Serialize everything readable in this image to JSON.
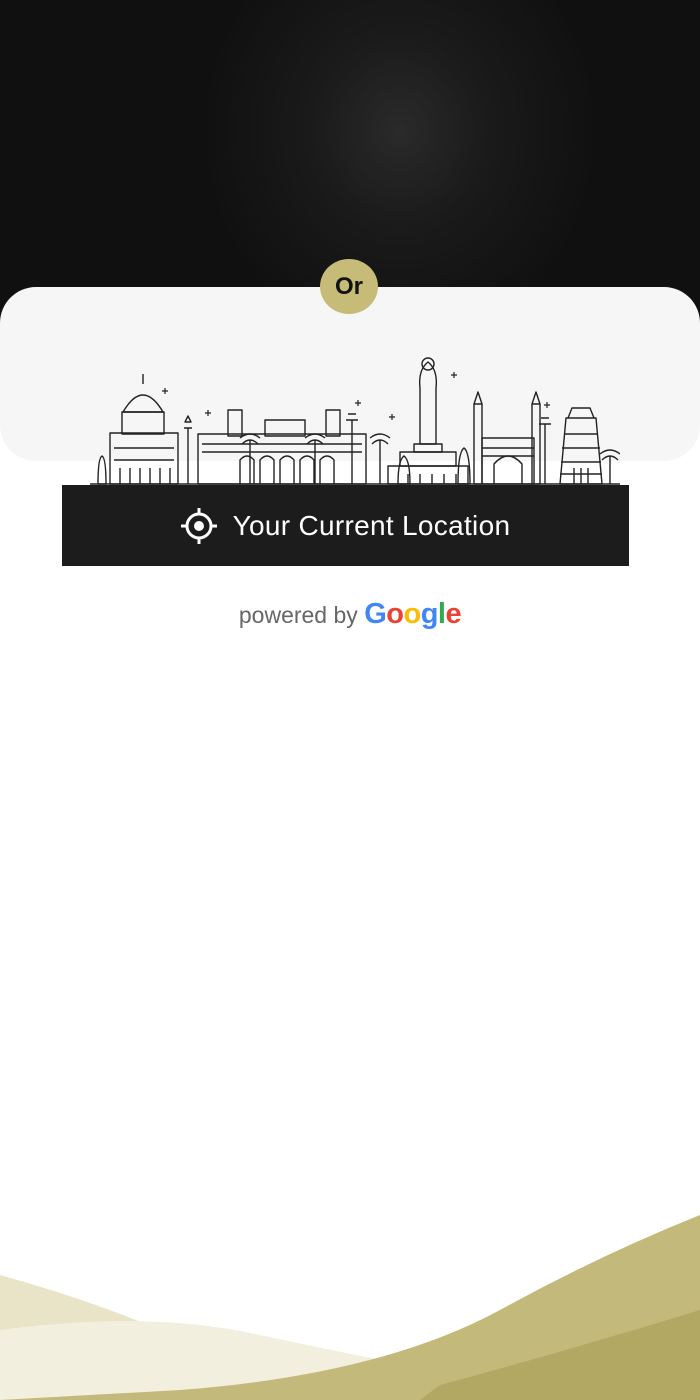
{
  "or_badge": {
    "label": "Or"
  },
  "location_button": {
    "label": "Your Current Location",
    "icon": "crosshair-icon"
  },
  "attribution": {
    "prefix": "powered by",
    "brand": [
      "G",
      "o",
      "o",
      "g",
      "l",
      "e"
    ],
    "brand_colors": [
      "#4285F4",
      "#EA4335",
      "#FBBC05",
      "#4285F4",
      "#34A853",
      "#EA4335"
    ]
  },
  "colors": {
    "accent": "#c6bc78",
    "dark": "#1c1c1c",
    "card": "#f6f6f6"
  }
}
